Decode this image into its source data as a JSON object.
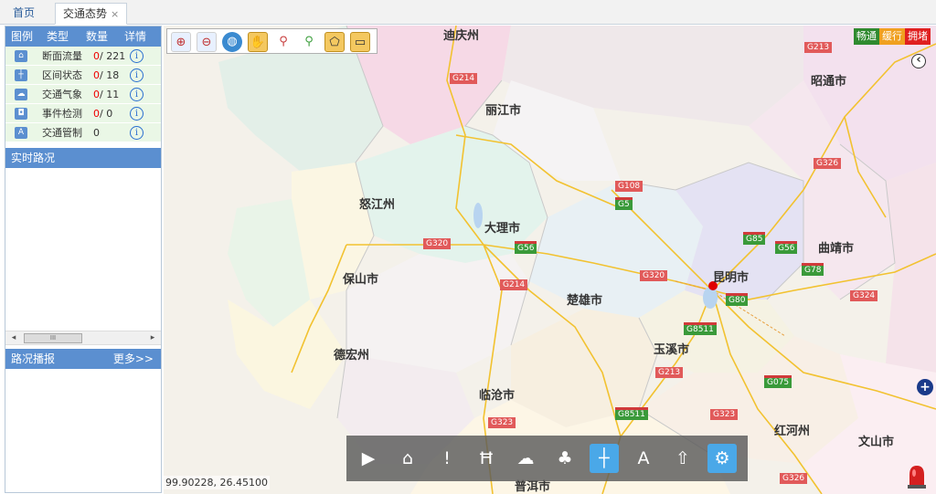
{
  "tabs": [
    {
      "label": "首页"
    },
    {
      "label": "交通态势",
      "close": "×"
    }
  ],
  "legend": {
    "headers": [
      "图例",
      "类型",
      "数量",
      "详情"
    ],
    "rows": [
      {
        "icon": "road-section-icon",
        "glyph": "⌂",
        "label": "断面流量",
        "prefix": "0",
        "total": "/ 221"
      },
      {
        "icon": "interval-icon",
        "glyph": "┼",
        "label": "区间状态",
        "prefix": "0",
        "total": "/ 18"
      },
      {
        "icon": "weather-icon",
        "glyph": "☁",
        "label": "交通气象",
        "prefix": "0",
        "total": "/ 11"
      },
      {
        "icon": "event-detect-icon",
        "glyph": "◘",
        "label": "事件检测",
        "prefix": "0",
        "total": "/ 0"
      },
      {
        "icon": "traffic-control-icon",
        "glyph": "A",
        "label": "交通管制",
        "prefix": "",
        "total": "0"
      }
    ],
    "info_glyph": "i"
  },
  "realtime": {
    "title": "实时路况"
  },
  "scroll": {
    "left": "◂",
    "right": "▸",
    "thumb": "III"
  },
  "capture": {
    "title": "路况播报",
    "more": "更多>>"
  },
  "status_legend": [
    {
      "label": "畅通",
      "color": "#2f8a2f"
    },
    {
      "label": "缓行",
      "color": "#f0a020"
    },
    {
      "label": "拥堵",
      "color": "#e02020"
    }
  ],
  "cities": [
    "迪庆州",
    "丽江市",
    "昭通市",
    "怒江州",
    "大理市",
    "曲靖市",
    "保山市",
    "昆明市",
    "楚雄市",
    "德宏州",
    "玉溪市",
    "临沧市",
    "红河州",
    "文山市",
    "普洱市"
  ],
  "roads": [
    "G214",
    "G213",
    "G108",
    "G5",
    "G326",
    "G320",
    "G56",
    "G85",
    "G56",
    "G78",
    "G214",
    "G320",
    "G324",
    "G80",
    "G8511",
    "G213",
    "G075",
    "G8511",
    "G323",
    "G323",
    "G326"
  ],
  "map_tools": [
    "zoom-in-icon",
    "zoom-out-icon",
    "globe-icon",
    "pan-hand-icon",
    "zoom-rect-out-icon",
    "zoom-rect-in-icon",
    "select-polygon-icon",
    "select-rect-icon"
  ],
  "bottom_tools": [
    {
      "name": "camera-icon",
      "glyph": "▶"
    },
    {
      "name": "section-flow-icon",
      "glyph": "⌂"
    },
    {
      "name": "alert-icon",
      "glyph": "!"
    },
    {
      "name": "toll-gate-icon",
      "glyph": "Ħ"
    },
    {
      "name": "weather-icon",
      "glyph": "☁"
    },
    {
      "name": "network-icon",
      "glyph": "♣"
    },
    {
      "name": "interval-status-icon",
      "glyph": "┼"
    },
    {
      "name": "control-icon",
      "glyph": "A"
    },
    {
      "name": "event-icon",
      "glyph": "⇧"
    },
    {
      "name": "settings-icon",
      "glyph": "⚙"
    }
  ],
  "coordinates": "99.90228, 26.45100",
  "collapse_glyph": "‹",
  "add_glyph": "+"
}
